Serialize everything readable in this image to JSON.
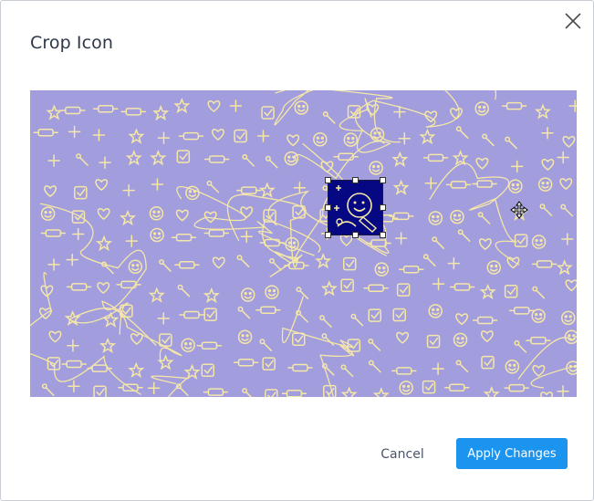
{
  "dialog": {
    "title": "Crop Icon",
    "close_icon": "close-x-icon"
  },
  "canvas": {
    "image_description_icon": "doodle-pattern-image",
    "pattern_bg_color": "#a29ddd",
    "pattern_line_color": "#f5e7a8",
    "crop_selection_color": "#050783",
    "cursor_icon": "move-cursor-icon"
  },
  "footer": {
    "cancel_label": "Cancel",
    "apply_label": "Apply Changes",
    "apply_color": "#1b94f0"
  }
}
